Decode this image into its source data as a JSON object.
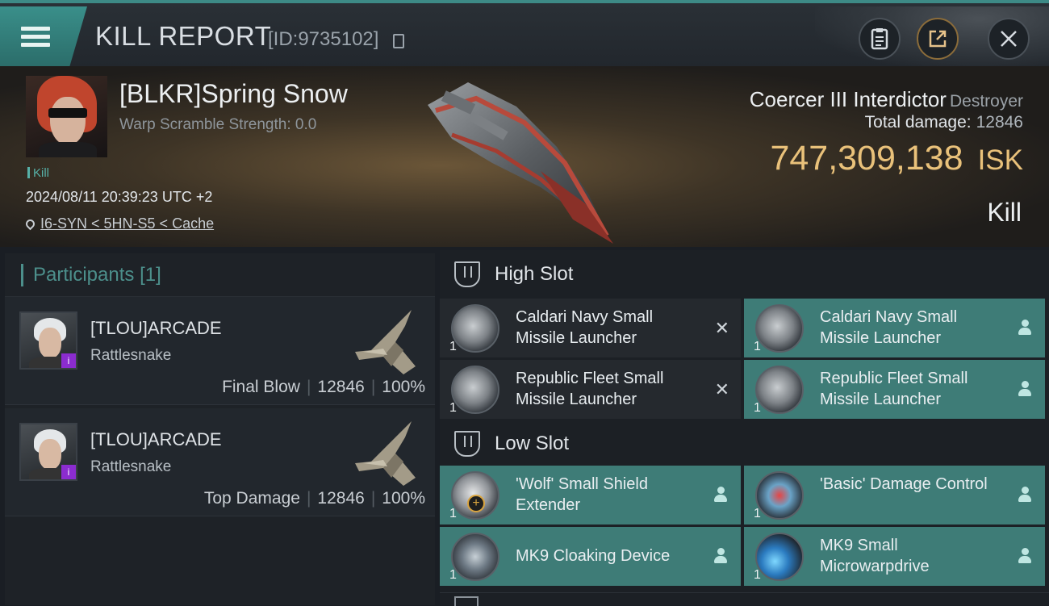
{
  "header": {
    "title": "KILL REPORT",
    "report_id": "[ID:9735102]"
  },
  "victim": {
    "name": "[BLKR]Spring Snow",
    "warp_scramble": "Warp Scramble Strength: 0.0",
    "kill_tag": "Kill",
    "datetime": "2024/08/11 20:39:23 UTC +2",
    "location": "I6-SYN < 5HN-S5 < Cache",
    "ship_name": "Coercer III Interdictor",
    "ship_class": "Destroyer",
    "total_damage_label": "Total damage:",
    "total_damage": "12846",
    "isk_value": "747,309,138",
    "isk_unit": "ISK",
    "result": "Kill"
  },
  "participants": {
    "title": "Participants",
    "count": "[1]",
    "list": [
      {
        "name": "[TLOU]ARCADE",
        "ship": "Rattlesnake",
        "role": "Final Blow",
        "damage": "12846",
        "percent": "100%"
      },
      {
        "name": "[TLOU]ARCADE",
        "ship": "Rattlesnake",
        "role": "Top Damage",
        "damage": "12846",
        "percent": "100%"
      }
    ]
  },
  "slots": {
    "high": {
      "label": "High Slot",
      "modules": [
        {
          "name": "Caldari Navy Small Missile Launcher",
          "qty": "1",
          "status": "destroyed"
        },
        {
          "name": "Caldari Navy Small Missile Launcher",
          "qty": "1",
          "status": "dropped"
        },
        {
          "name": "Republic Fleet Small Missile Launcher",
          "qty": "1",
          "status": "destroyed"
        },
        {
          "name": "Republic Fleet Small Missile Launcher",
          "qty": "1",
          "status": "dropped"
        }
      ]
    },
    "low": {
      "label": "Low Slot",
      "modules": [
        {
          "name": "'Wolf' Small Shield Extender",
          "qty": "1",
          "status": "dropped"
        },
        {
          "name": "'Basic' Damage Control",
          "qty": "1",
          "status": "dropped"
        },
        {
          "name": "MK9 Cloaking Device",
          "qty": "1",
          "status": "dropped"
        },
        {
          "name": "MK9 Small Microwarpdrive",
          "qty": "1",
          "status": "dropped"
        }
      ]
    },
    "destroyed_mark": "✕"
  },
  "colors": {
    "accent": "#3e7c77",
    "isk_gold": "#e9c17a",
    "purple_badge": "#8b2ccf"
  }
}
